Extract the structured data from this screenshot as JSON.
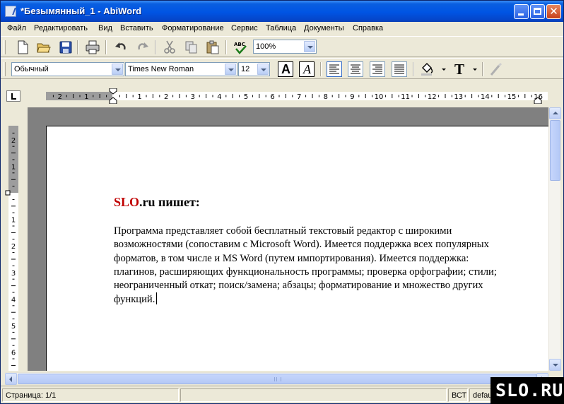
{
  "window": {
    "title": "*Безымянный_1 - AbiWord"
  },
  "menu": [
    "Файл",
    "Редактировать",
    "Вид",
    "Вставить",
    "Форматирование",
    "Сервис",
    "Таблица",
    "Документы",
    "Справка"
  ],
  "toolbar": {
    "buttons": [
      "new-file-icon",
      "open-folder-icon",
      "save-icon",
      "print-icon",
      "undo-icon",
      "redo-icon",
      "cut-icon",
      "copy-icon",
      "paste-icon",
      "spellcheck-icon"
    ],
    "zoom": "100%"
  },
  "format_toolbar": {
    "style": "Обычный",
    "font": "Times New Roman",
    "size": "12",
    "bold_label": "A",
    "italic_label": "A",
    "text_color_label": "T"
  },
  "ruler": {
    "h_labels_left": [
      "2",
      "1"
    ],
    "h_labels_right": [
      "1",
      "2",
      "3",
      "4",
      "5",
      "6",
      "7",
      "8",
      "9",
      "10",
      "11",
      "12",
      "13",
      "14",
      "15",
      "16"
    ],
    "v_labels_top": [
      "2",
      "1"
    ],
    "v_labels": [
      "1",
      "2",
      "3",
      "4",
      "5",
      "6"
    ]
  },
  "document": {
    "heading_brand": "SLO",
    "heading_rest": ".ru пишет:",
    "body_lines": [
      "Программа представляет собой бесплатный текстовый редактор с широкими",
      "возможностями (сопоставим с Microsoft Word). Имеется поддержка всех популярных",
      "форматов, в том числе и MS Word (путем импортирования). Имеется поддержка:",
      "плагинов, расширяющих функциональность программы; проверка орфографии; стили;",
      "неограниченный откат; поиск/замена; абзацы; форматирование и множество других",
      "функций."
    ]
  },
  "statusbar": {
    "page": "Страница: 1/1",
    "mode": "ВСТ",
    "lang": "defau"
  },
  "watermark": "SLO.RU"
}
